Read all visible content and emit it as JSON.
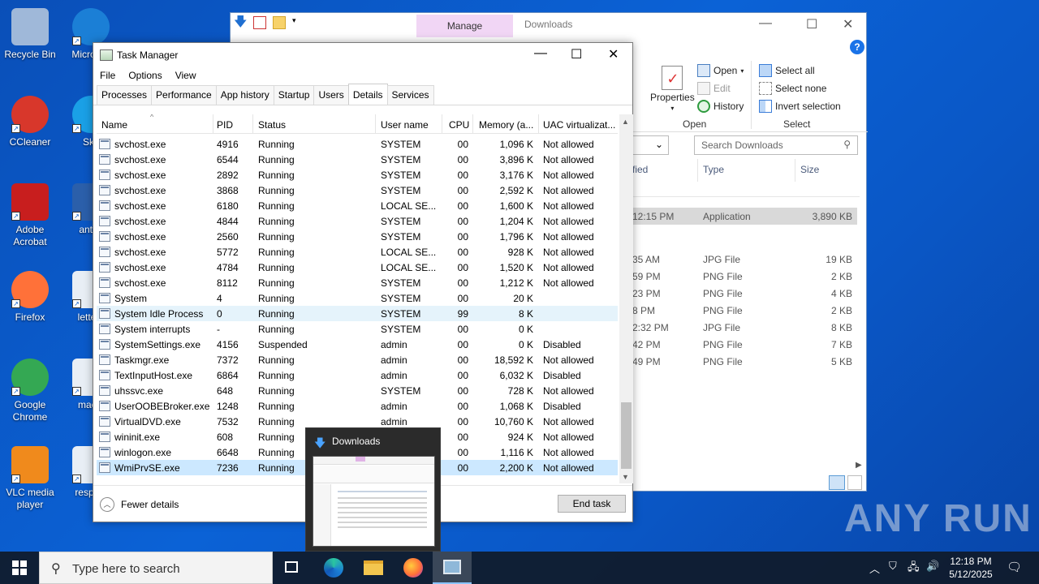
{
  "desktop": {
    "icons": [
      {
        "label": "Recycle Bin",
        "icon": "recycle-bin-icon"
      },
      {
        "label": "Micro Ed",
        "icon": "edge-icon"
      },
      {
        "label": "CCleaner",
        "icon": "ccleaner-icon"
      },
      {
        "label": "Sky",
        "icon": "skype-icon"
      },
      {
        "label": "Adobe Acrobat",
        "icon": "acrobat-icon"
      },
      {
        "label": "antiof",
        "icon": "word-doc-icon"
      },
      {
        "label": "Firefox",
        "icon": "firefox-icon"
      },
      {
        "label": "letterc",
        "icon": "image-file-icon"
      },
      {
        "label": "Google Chrome",
        "icon": "chrome-icon"
      },
      {
        "label": "machi",
        "icon": "image-file-icon"
      },
      {
        "label": "VLC media player",
        "icon": "vlc-icon"
      },
      {
        "label": "respect",
        "icon": "image-file-icon"
      }
    ],
    "watermark": "ANY RUN"
  },
  "explorer": {
    "title": "Downloads",
    "manage_tab": "Manage",
    "ribbon": {
      "properties": "Properties",
      "open": "Open",
      "edit": "Edit",
      "history": "History",
      "open_group": "Open",
      "select_all": "Select all",
      "select_none": "Select none",
      "invert_selection": "Invert selection",
      "select_group": "Select"
    },
    "search_placeholder": "Search Downloads",
    "columns": {
      "modified_partial": "fied",
      "type": "Type",
      "size": "Size"
    },
    "files": [
      {
        "date": "12:15 PM",
        "type": "Application",
        "size": "3,890 KB",
        "selected": true
      },
      {
        "date": "35 AM",
        "type": "JPG File",
        "size": "19 KB"
      },
      {
        "date": "59 PM",
        "type": "PNG File",
        "size": "2 KB"
      },
      {
        "date": "23 PM",
        "type": "PNG File",
        "size": "4 KB"
      },
      {
        "date": "8 PM",
        "type": "PNG File",
        "size": "2 KB"
      },
      {
        "date": "2:32 PM",
        "type": "JPG File",
        "size": "8 KB"
      },
      {
        "date": "42 PM",
        "type": "PNG File",
        "size": "7 KB"
      },
      {
        "date": "49 PM",
        "type": "PNG File",
        "size": "5 KB"
      }
    ]
  },
  "taskmgr": {
    "title": "Task Manager",
    "menu": [
      "File",
      "Options",
      "View"
    ],
    "tabs": [
      "Processes",
      "Performance",
      "App history",
      "Startup",
      "Users",
      "Details",
      "Services"
    ],
    "active_tab": "Details",
    "columns": [
      "Name",
      "PID",
      "Status",
      "User name",
      "CPU",
      "Memory (a...",
      "UAC virtualizat..."
    ],
    "rows": [
      {
        "name": "svchost.exe",
        "pid": "4916",
        "status": "Running",
        "user": "SYSTEM",
        "cpu": "00",
        "mem": "1,096 K",
        "uac": "Not allowed"
      },
      {
        "name": "svchost.exe",
        "pid": "6544",
        "status": "Running",
        "user": "SYSTEM",
        "cpu": "00",
        "mem": "3,896 K",
        "uac": "Not allowed"
      },
      {
        "name": "svchost.exe",
        "pid": "2892",
        "status": "Running",
        "user": "SYSTEM",
        "cpu": "00",
        "mem": "3,176 K",
        "uac": "Not allowed"
      },
      {
        "name": "svchost.exe",
        "pid": "3868",
        "status": "Running",
        "user": "SYSTEM",
        "cpu": "00",
        "mem": "2,592 K",
        "uac": "Not allowed"
      },
      {
        "name": "svchost.exe",
        "pid": "6180",
        "status": "Running",
        "user": "LOCAL SE...",
        "cpu": "00",
        "mem": "1,600 K",
        "uac": "Not allowed"
      },
      {
        "name": "svchost.exe",
        "pid": "4844",
        "status": "Running",
        "user": "SYSTEM",
        "cpu": "00",
        "mem": "1,204 K",
        "uac": "Not allowed"
      },
      {
        "name": "svchost.exe",
        "pid": "2560",
        "status": "Running",
        "user": "SYSTEM",
        "cpu": "00",
        "mem": "1,796 K",
        "uac": "Not allowed"
      },
      {
        "name": "svchost.exe",
        "pid": "5772",
        "status": "Running",
        "user": "LOCAL SE...",
        "cpu": "00",
        "mem": "928 K",
        "uac": "Not allowed"
      },
      {
        "name": "svchost.exe",
        "pid": "4784",
        "status": "Running",
        "user": "LOCAL SE...",
        "cpu": "00",
        "mem": "1,520 K",
        "uac": "Not allowed"
      },
      {
        "name": "svchost.exe",
        "pid": "8112",
        "status": "Running",
        "user": "SYSTEM",
        "cpu": "00",
        "mem": "1,212 K",
        "uac": "Not allowed"
      },
      {
        "name": "System",
        "pid": "4",
        "status": "Running",
        "user": "SYSTEM",
        "cpu": "00",
        "mem": "20 K",
        "uac": ""
      },
      {
        "name": "System Idle Process",
        "pid": "0",
        "status": "Running",
        "user": "SYSTEM",
        "cpu": "99",
        "mem": "8 K",
        "uac": "",
        "highlight": true
      },
      {
        "name": "System interrupts",
        "pid": "-",
        "status": "Running",
        "user": "SYSTEM",
        "cpu": "00",
        "mem": "0 K",
        "uac": ""
      },
      {
        "name": "SystemSettings.exe",
        "pid": "4156",
        "status": "Suspended",
        "user": "admin",
        "cpu": "00",
        "mem": "0 K",
        "uac": "Disabled"
      },
      {
        "name": "Taskmgr.exe",
        "pid": "7372",
        "status": "Running",
        "user": "admin",
        "cpu": "00",
        "mem": "18,592 K",
        "uac": "Not allowed"
      },
      {
        "name": "TextInputHost.exe",
        "pid": "6864",
        "status": "Running",
        "user": "admin",
        "cpu": "00",
        "mem": "6,032 K",
        "uac": "Disabled"
      },
      {
        "name": "uhssvc.exe",
        "pid": "648",
        "status": "Running",
        "user": "SYSTEM",
        "cpu": "00",
        "mem": "728 K",
        "uac": "Not allowed"
      },
      {
        "name": "UserOOBEBroker.exe",
        "pid": "1248",
        "status": "Running",
        "user": "admin",
        "cpu": "00",
        "mem": "1,068 K",
        "uac": "Disabled"
      },
      {
        "name": "VirtualDVD.exe",
        "pid": "7532",
        "status": "Running",
        "user": "admin",
        "cpu": "00",
        "mem": "10,760 K",
        "uac": "Not allowed"
      },
      {
        "name": "wininit.exe",
        "pid": "608",
        "status": "Running",
        "user": "SYSTEM",
        "cpu": "00",
        "mem": "924 K",
        "uac": "Not allowed"
      },
      {
        "name": "winlogon.exe",
        "pid": "6648",
        "status": "Running",
        "user": "SYSTEM",
        "cpu": "00",
        "mem": "1,116 K",
        "uac": "Not allowed"
      },
      {
        "name": "WmiPrvSE.exe",
        "pid": "7236",
        "status": "Running",
        "user": "SYSTEM",
        "cpu": "00",
        "mem": "2,200 K",
        "uac": "Not allowed",
        "selected": true
      }
    ],
    "fewer_details": "Fewer details",
    "end_task": "End task"
  },
  "thumbnail": {
    "title": "Downloads"
  },
  "taskbar": {
    "search_placeholder": "Type here to search",
    "time": "12:18 PM",
    "date": "5/12/2025"
  }
}
